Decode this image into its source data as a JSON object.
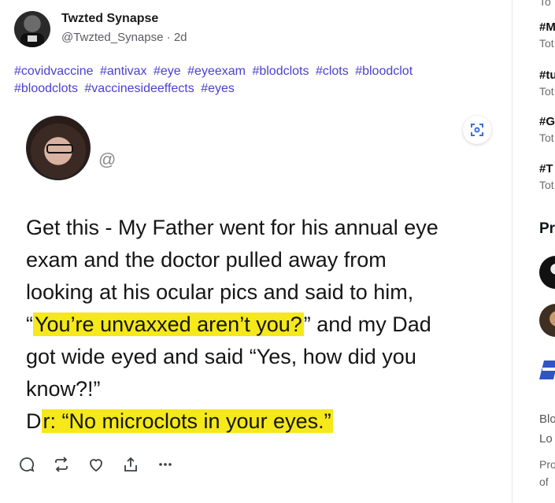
{
  "post": {
    "author_name": "Twzted Synapse",
    "author_handle": "@Twzted_Synapse",
    "separator": "·",
    "time_ago": "2d",
    "hashtags": [
      "#covidvaccine",
      "#antivax",
      "#eye",
      "#eyeexam",
      "#blodclots",
      "#clots",
      "#bloodclot",
      "#bloodclots",
      "#vaccinesideeffects",
      "#eyes"
    ]
  },
  "embed": {
    "handle": "@",
    "lines": [
      {
        "text": "Get this - My Father went for his annual eye"
      },
      {
        "text": "exam and the doctor pulled away from"
      },
      {
        "text": "looking at his ocular pics and said to him,"
      },
      {
        "pre": "“",
        "hl": "You’re unvaxxed aren’t you?",
        "post": "” and my Dad"
      },
      {
        "text": "got wide eyed and said “Yes, how did you"
      },
      {
        "text": "know?!”"
      },
      {
        "pre": "D",
        "hl": "r: “No microclots in your eyes.”",
        "post": ""
      }
    ]
  },
  "actions": [
    "reply-icon",
    "repost-icon",
    "like-icon",
    "share-icon",
    "more-icon"
  ],
  "sidebar": {
    "trends": [
      {
        "tag": "",
        "sub": "To"
      },
      {
        "tag": "#M",
        "sub": "Tot"
      },
      {
        "tag": "#tu",
        "sub": "Tot"
      },
      {
        "tag": "#G",
        "sub": "Tot"
      },
      {
        "tag": "#T",
        "sub": "Tot"
      }
    ],
    "heading": "Pr",
    "text1": "Blo",
    "text2": "Lo",
    "small1": "Pro",
    "small2": "of"
  },
  "colors": {
    "hashtag": "#4a3fd1",
    "highlight": "#f5e81b"
  }
}
